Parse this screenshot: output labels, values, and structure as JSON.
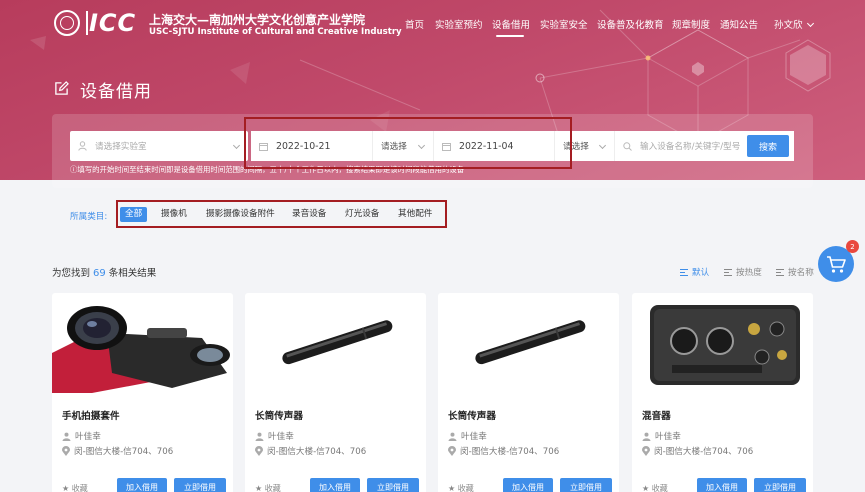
{
  "header": {
    "logo_name": "ICC",
    "logo_cn": "上海交大—南加州大学文化创意产业学院",
    "logo_en": "USC-SJTU Institute of Cultural and Creative Industry",
    "nav": [
      {
        "label": "首页"
      },
      {
        "label": "实验室预约"
      },
      {
        "label": "设备借用",
        "active": true
      },
      {
        "label": "实验室安全"
      },
      {
        "label": "设备普及化教育"
      },
      {
        "label": "规章制度"
      },
      {
        "label": "通知公告"
      }
    ],
    "user": "孙文欣"
  },
  "page": {
    "title": "设备借用",
    "title_icon": "edit-icon"
  },
  "filters": {
    "lab_placeholder": "请选择实验室",
    "start_date": "2022-10-21",
    "start_time": "请选择",
    "end_date": "2022-11-04",
    "end_time": "请选择",
    "search_placeholder": "输入设备名称/关键字/型号",
    "search_button": "搜索",
    "hint": "ⓘ填写的开始时间至结束时间即是设备借用时间范围的间隔，五十/十个工作日以内，搜索结果即是该时间段能借用的设备"
  },
  "categories": {
    "label": "所属类目:",
    "items": [
      {
        "label": "全部",
        "active": true
      },
      {
        "label": "摄像机"
      },
      {
        "label": "摄影摄像设备附件"
      },
      {
        "label": "录音设备"
      },
      {
        "label": "灯光设备"
      },
      {
        "label": "其他配件"
      }
    ]
  },
  "cart": {
    "count": "2",
    "icon": "cart-icon"
  },
  "results": {
    "prefix": "为您找到",
    "count": "69",
    "suffix": "条相关结果",
    "sort": [
      {
        "label": "默认",
        "active": true
      },
      {
        "label": "按热度"
      },
      {
        "label": "按名称"
      }
    ]
  },
  "cards": [
    {
      "name": "手机拍摄套件",
      "owner": "叶佳幸",
      "location": "闵-图信大楼-信704、706",
      "fav": "收藏",
      "add": "加入借用",
      "now": "立即借用"
    },
    {
      "name": "长筒传声器",
      "owner": "叶佳幸",
      "location": "闵-图信大楼-信704、706",
      "fav": "收藏",
      "add": "加入借用",
      "now": "立即借用"
    },
    {
      "name": "长筒传声器",
      "owner": "叶佳幸",
      "location": "闵-图信大楼-信704、706",
      "fav": "收藏",
      "add": "加入借用",
      "now": "立即借用"
    },
    {
      "name": "混音器",
      "owner": "叶佳幸",
      "location": "闵-图信大楼-信704、706",
      "fav": "收藏",
      "add": "加入借用",
      "now": "立即借用"
    }
  ],
  "colors": {
    "brand": "#c0496a",
    "accent": "#3f8ee9",
    "annotation": "#a41d22"
  }
}
